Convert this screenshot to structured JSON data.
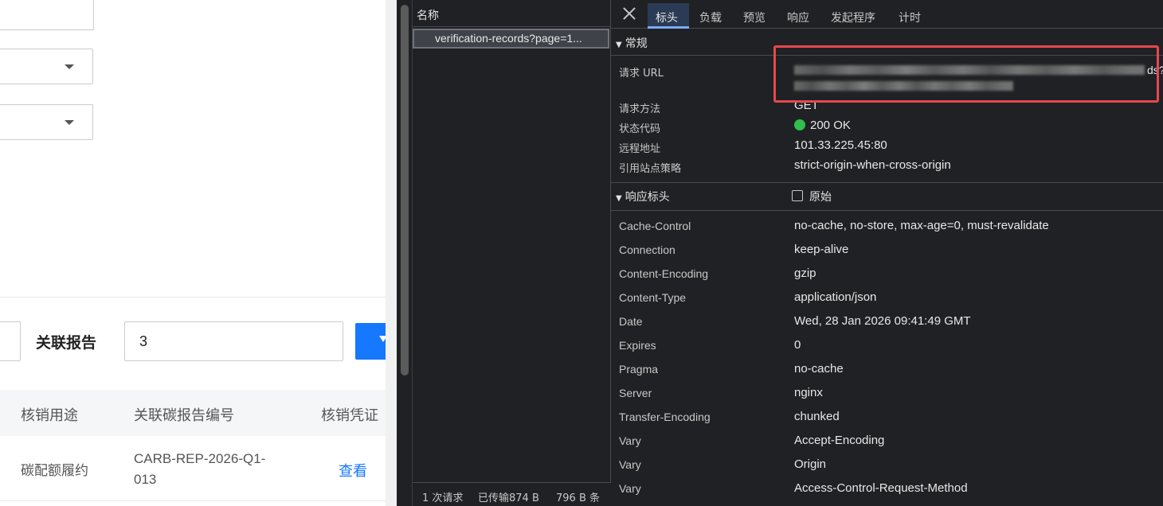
{
  "webpage": {
    "filter_label": "关联报告",
    "filter_value": "3",
    "table_headers": [
      "核销用途",
      "关联碳报告编号",
      "核销凭证"
    ],
    "row": {
      "purpose": "碳配额履约",
      "code_line1": "CARB-REP-2026-Q1-",
      "code_line2": "013",
      "link": "查看"
    },
    "colors": {
      "primary": "#1677ff"
    }
  },
  "devtools": {
    "name_header": "名称",
    "request_name": "verification-records?page=1...",
    "footer": [
      "1 次请求",
      "已传输874 B",
      "796 B 条"
    ],
    "tabs": [
      "标头",
      "负载",
      "预览",
      "响应",
      "发起程序",
      "计时"
    ],
    "active_tab": "标头",
    "general": {
      "title": "常规",
      "rows": [
        {
          "key": "请求 URL",
          "value": ""
        },
        {
          "key": "请求方法",
          "value": "GET"
        },
        {
          "key": "状态代码",
          "value": "200 OK"
        },
        {
          "key": "远程地址",
          "value": "101.33.225.45:80"
        },
        {
          "key": "引用站点策略",
          "value": "strict-origin-when-cross-origin"
        }
      ],
      "url_visible_tail": "ds?"
    },
    "response_headers": {
      "title": "响应标头",
      "raw_label": "原始",
      "rows": [
        {
          "key": "Cache-Control",
          "value": "no-cache, no-store, max-age=0, must-revalidate"
        },
        {
          "key": "Connection",
          "value": "keep-alive"
        },
        {
          "key": "Content-Encoding",
          "value": "gzip"
        },
        {
          "key": "Content-Type",
          "value": "application/json"
        },
        {
          "key": "Date",
          "value": "Wed, 28 Jan 2026 09:41:49 GMT"
        },
        {
          "key": "Expires",
          "value": "0"
        },
        {
          "key": "Pragma",
          "value": "no-cache"
        },
        {
          "key": "Server",
          "value": "nginx"
        },
        {
          "key": "Transfer-Encoding",
          "value": "chunked"
        },
        {
          "key": "Vary",
          "value": "Accept-Encoding"
        },
        {
          "key": "Vary",
          "value": "Origin"
        },
        {
          "key": "Vary",
          "value": "Access-Control-Request-Method"
        }
      ]
    },
    "colors": {
      "status_ok": "#2fbf4d",
      "highlight_box": "#e5484d",
      "tab_underline": "#7cacf8"
    }
  }
}
